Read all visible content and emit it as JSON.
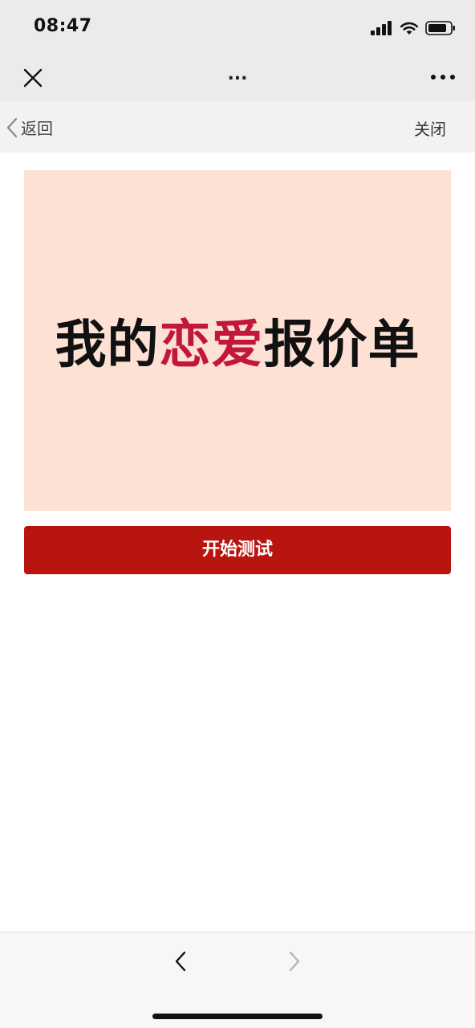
{
  "status_bar": {
    "time": "08:47",
    "icons": [
      "signal-icon",
      "wifi-icon",
      "battery-icon"
    ]
  },
  "nav_bar": {
    "close_icon": "close-icon",
    "title": "...",
    "more_icon": "more-icon"
  },
  "sub_nav": {
    "back_label": "返回",
    "close_label": "关闭"
  },
  "banner": {
    "title_part1": "我的",
    "title_accent": "恋爱",
    "title_part2": "报价单",
    "background_color": "#fde1d4",
    "accent_color": "#c2173a"
  },
  "start_button": {
    "label": "开始测试",
    "color": "#b81510"
  },
  "bottom_bar": {
    "back_icon": "chevron-left-icon",
    "forward_icon": "chevron-right-icon"
  }
}
